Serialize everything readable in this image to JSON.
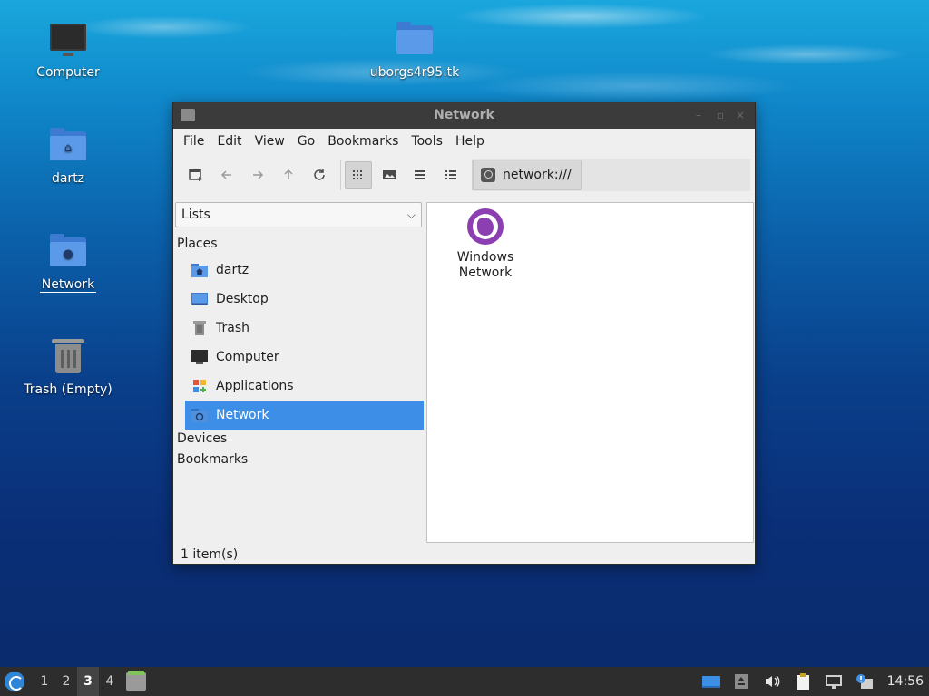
{
  "desktop": {
    "icons": [
      {
        "label": "Computer"
      },
      {
        "label": "uborgs4r95.tk"
      },
      {
        "label": "dartz"
      },
      {
        "label": "Network"
      },
      {
        "label": "Trash (Empty)"
      }
    ]
  },
  "window": {
    "title": "Network",
    "menu": [
      "File",
      "Edit",
      "View",
      "Go",
      "Bookmarks",
      "Tools",
      "Help"
    ],
    "location": "network:///",
    "sidebar": {
      "mode": "Lists",
      "places_heading": "Places",
      "places": [
        {
          "label": "dartz",
          "icon": "home-folder-icon"
        },
        {
          "label": "Desktop",
          "icon": "desktop-icon"
        },
        {
          "label": "Trash",
          "icon": "trash-icon"
        },
        {
          "label": "Computer",
          "icon": "computer-icon"
        },
        {
          "label": "Applications",
          "icon": "applications-icon"
        },
        {
          "label": "Network",
          "icon": "network-icon",
          "selected": true
        }
      ],
      "devices_heading": "Devices",
      "bookmarks_heading": "Bookmarks"
    },
    "content": {
      "items": [
        {
          "line1": "Windows",
          "line2": "Network",
          "icon": "globe-icon"
        }
      ]
    },
    "status": "1 item(s)"
  },
  "taskbar": {
    "workspaces": [
      "1",
      "2",
      "3",
      "4"
    ],
    "active_workspace": "3",
    "clock": "14:56"
  },
  "colors": {
    "selection": "#3d8ee6",
    "titlebar": "#3b3b3b",
    "taskbar": "#2d2d2d",
    "folder": "#5b9ae8",
    "network_globe": "#8b3fb0"
  }
}
